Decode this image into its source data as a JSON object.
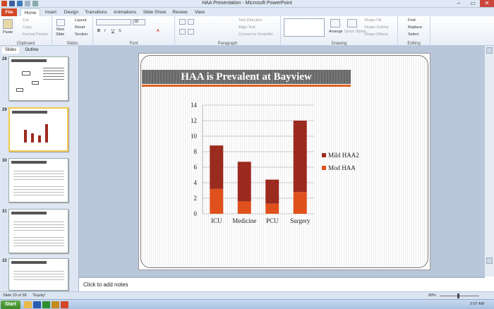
{
  "window": {
    "title": "HAA Presentation - Microsoft PowerPoint"
  },
  "tabs": [
    "File",
    "Home",
    "Insert",
    "Design",
    "Transitions",
    "Animations",
    "Slide Show",
    "Review",
    "View"
  ],
  "ribbon": {
    "clipboard": {
      "paste": "Paste",
      "cut": "Cut",
      "copy": "Copy",
      "format_painter": "Format Painter",
      "label": "Clipboard"
    },
    "slides": {
      "new_slide": "New",
      "new_slide2": "Slide",
      "layout": "Layout",
      "reset": "Reset",
      "section": "Section",
      "label": "Slides"
    },
    "font": {
      "size": "28",
      "label": "Font"
    },
    "paragraph": {
      "text_direction": "Text Direction",
      "align_text": "Align Text",
      "convert": "Convert to SmartArt",
      "label": "Paragraph"
    },
    "drawing": {
      "arrange": "Arrange",
      "quick_styles": "Quick Styles",
      "shape_fill": "Shape Fill",
      "shape_outline": "Shape Outline",
      "shape_effects": "Shape Effects",
      "label": "Drawing"
    },
    "editing": {
      "find": "Find",
      "replace": "Replace",
      "select": "Select",
      "label": "Editing"
    }
  },
  "panel": {
    "tab_slides": "Slides",
    "tab_outline": "Outline",
    "thumbs": [
      "28",
      "29",
      "30",
      "31",
      "32"
    ],
    "thumb29_title": "HAA is Prevalent at Bayview"
  },
  "slide": {
    "title": "HAA is Prevalent at Bayview"
  },
  "chart_data": {
    "type": "bar",
    "stacked": true,
    "categories": [
      "ICU",
      "Medicine",
      "PCU",
      "Surgery"
    ],
    "series": [
      {
        "name": "Mod HAA",
        "values": [
          3.2,
          1.6,
          1.3,
          2.8
        ],
        "color": "#e0501c"
      },
      {
        "name": "Mild HAA2",
        "values": [
          5.6,
          5.1,
          3.1,
          9.2
        ],
        "color": "#9b2a1f"
      }
    ],
    "ylim": [
      0,
      14
    ],
    "yticks": [
      "0",
      "2",
      "4",
      "6",
      "8",
      "10",
      "12",
      "14"
    ],
    "legend_position": "right",
    "grid": true
  },
  "notes": {
    "placeholder": "Click to add notes"
  },
  "status": {
    "slide": "Slide 29 of 38",
    "theme": "\"Equity\"",
    "zoom": "89%"
  },
  "taskbar": {
    "start": "Start",
    "time": "3:07 AM"
  }
}
